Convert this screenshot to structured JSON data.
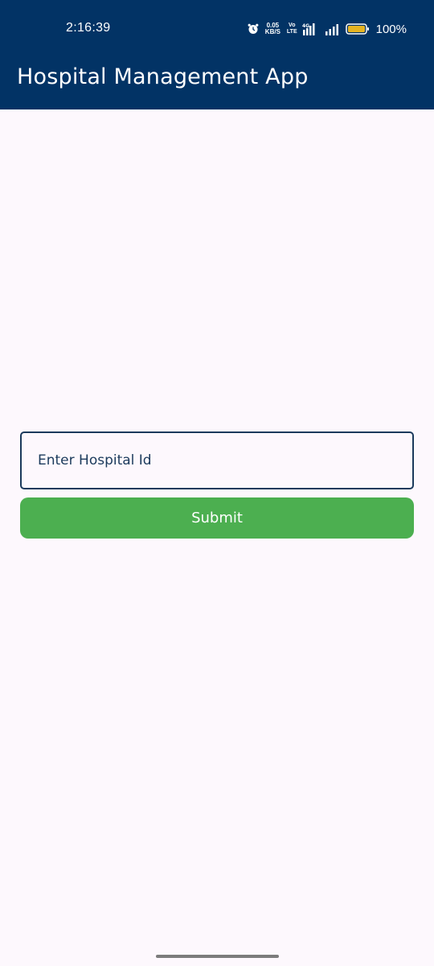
{
  "status_bar": {
    "time": "2:16:39",
    "net_speed_value": "0.05",
    "net_speed_unit": "KB/S",
    "volte_top": "Vo",
    "volte_bottom": "LTE",
    "network_type": "4G",
    "battery_percent": "100%",
    "icons": [
      "alarm-icon",
      "signal-4g-icon",
      "signal-icon",
      "battery-icon"
    ]
  },
  "app_bar": {
    "title": "Hospital Management App"
  },
  "form": {
    "hospital_id_placeholder": "Enter Hospital Id",
    "hospital_id_value": "",
    "submit_label": "Submit"
  },
  "colors": {
    "app_bar": "#023365",
    "background": "#fdf8fd",
    "submit_button": "#4caf50",
    "input_border": "#1b3a5c",
    "battery_fill": "#e6b422"
  }
}
